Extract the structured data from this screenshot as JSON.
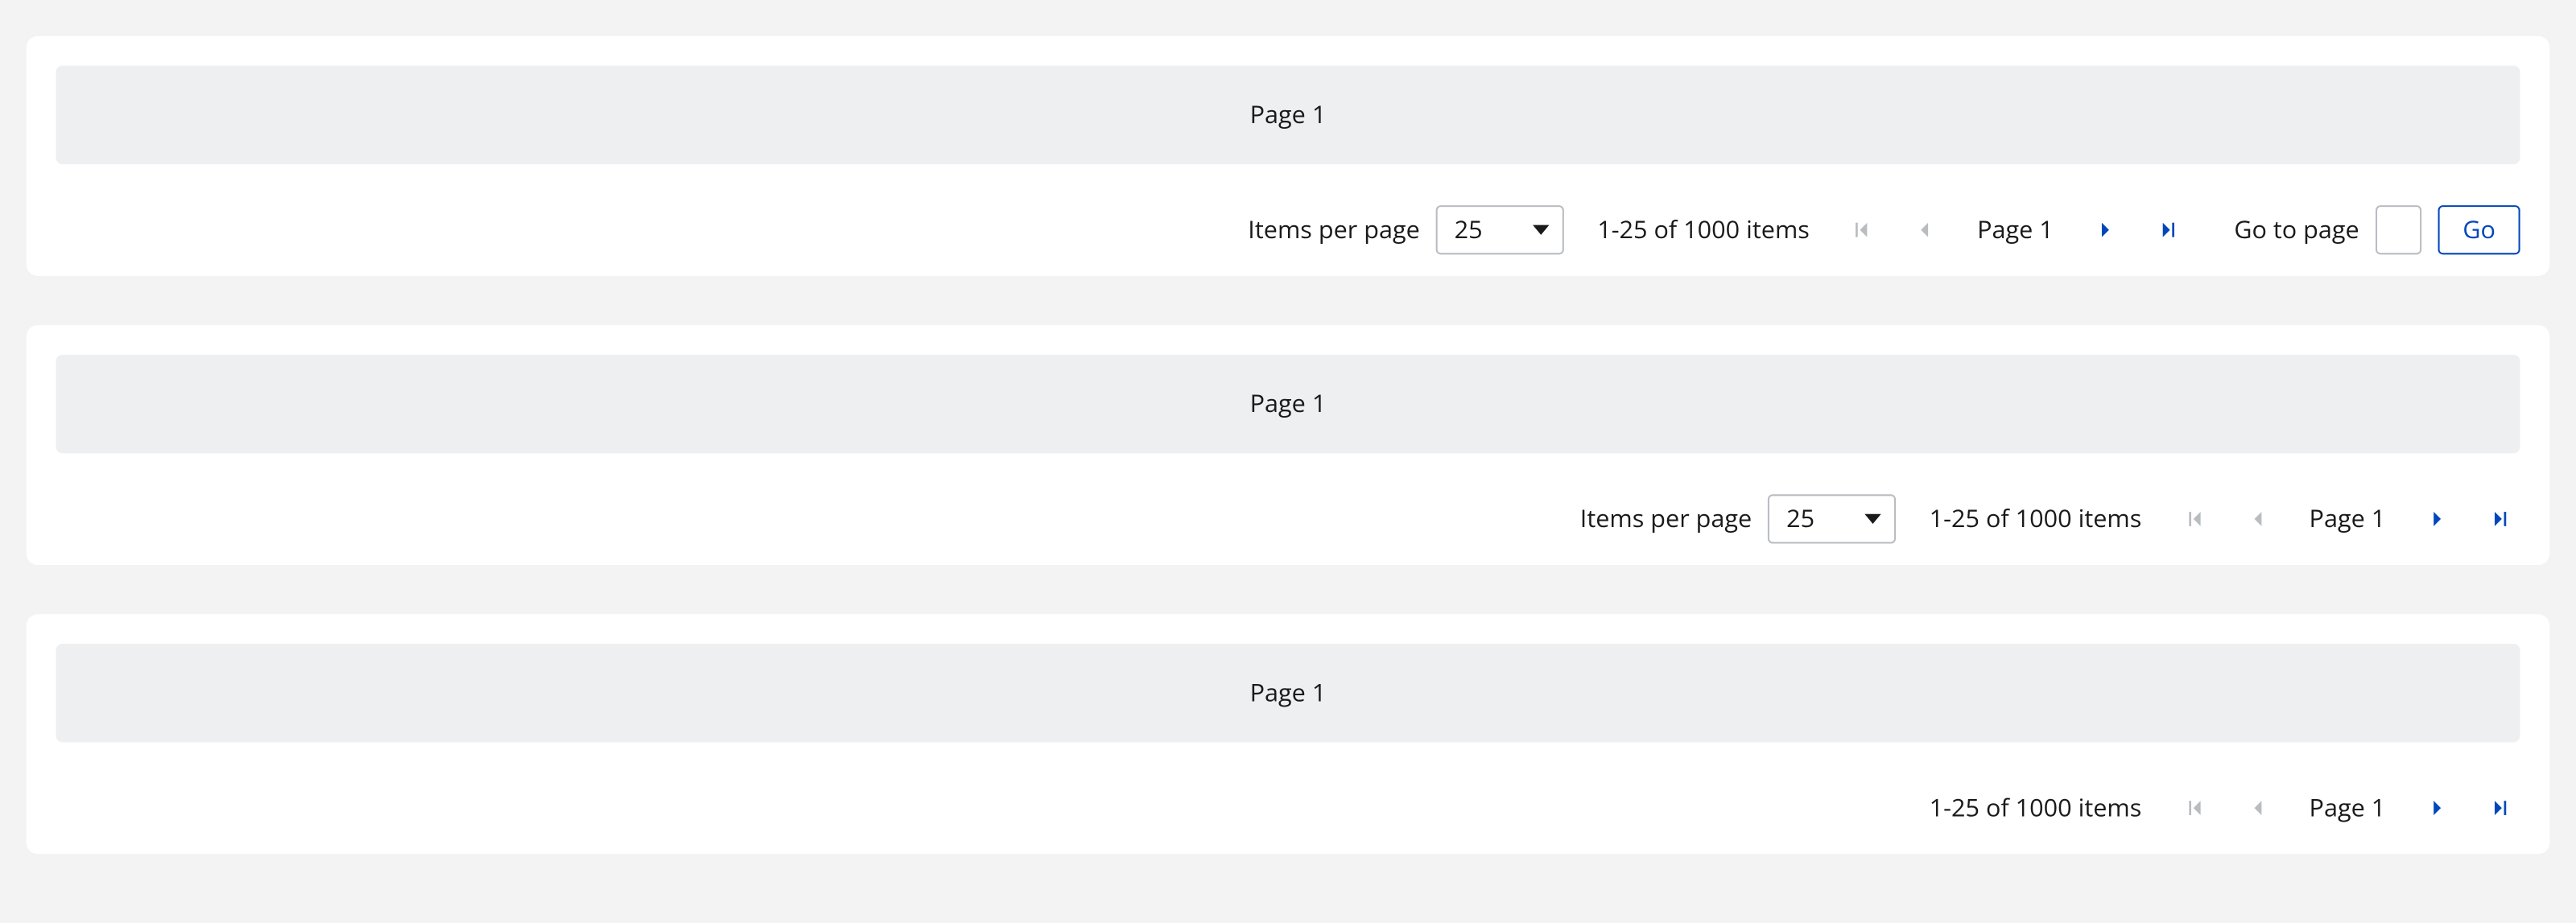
{
  "pager1": {
    "placeholder": "Page 1",
    "items_per_page_label": "Items per page",
    "items_per_page_value": "25",
    "summary": "1-25 of 1000 items",
    "page_label": "Page 1",
    "goto_label": "Go to page",
    "go_button": "Go"
  },
  "pager2": {
    "placeholder": "Page 1",
    "items_per_page_label": "Items per page",
    "items_per_page_value": "25",
    "summary": "1-25 of 1000 items",
    "page_label": "Page 1"
  },
  "pager3": {
    "placeholder": "Page 1",
    "summary": "1-25 of 1000 items",
    "page_label": "Page 1"
  }
}
